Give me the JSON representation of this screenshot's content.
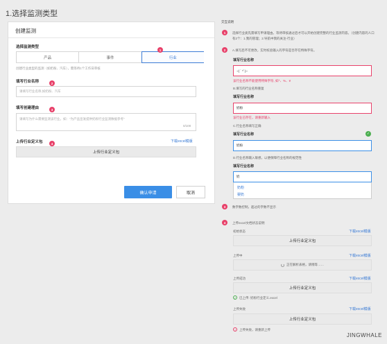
{
  "page": {
    "title": "1.选择监测类型",
    "watermark": "JINGWHALE"
  },
  "card": {
    "title": "创建监测",
    "type_label": "选择监测类型",
    "segments": [
      "产品",
      "事件",
      "行业"
    ],
    "type_hint": "创建行业类型的监测（如奶粉、汽车），需等待1个工作日审核",
    "name_label": "填写行业名称",
    "name_placeholder": "请填写行业名称,如奶粉、汽车",
    "reason_label": "填写创建理由",
    "reason_placeholder": "请填写为什么需要监测该行业。如：\"为产品宣发提供奶粉行业监测数据参考\"",
    "reason_counter": "0/100",
    "upload_label": "上传行业定义包",
    "download_link": "下载excel模版",
    "upload_button": "上传行业定义包",
    "confirm": "确认申请",
    "cancel": "取消"
  },
  "badges": [
    "1",
    "2",
    "3",
    "4"
  ],
  "notes": {
    "title": "交互说明",
    "n1": "选择行业类先需填写申请理由。等待审核通过后才可以开始创建完整的行业监测内容。（创建内容的人口有2个：1.我的管理；2.导航中我的关注-行业）",
    "n2": "A.填写后不可更改，实时校验输入的字符是否存在特殊字符。",
    "n3": "数字数控制，超过的字数不显示",
    "n4": "上传excel文档状态说明"
  },
  "demos": {
    "field_label": "填写行业名称",
    "a_value": "~( ˙ ^˙)~",
    "a_error": "该行业名称不能使用特殊字符, 如^、%、¥",
    "b_label": "B.填写的行业名称重复",
    "b_value": "奶粉",
    "b_error": "该行业已存在，请重新输入",
    "c_label": "C.行业名称填写正确",
    "c_value": "奶粉",
    "d_label": "D.行业名称输入联想，以便保障行业名称的规范性",
    "d_value": "奶",
    "d_options": [
      "奶粉",
      "婴奶"
    ]
  },
  "upload_states": {
    "download": "下载excel模版",
    "initial_label": "初始状态",
    "initial_btn": "上传行业定义包",
    "uploading_label": "上传中",
    "uploading_btn": "正在解析表格，请稍等……",
    "success_label": "上传成功",
    "success_btn": "上传行业定义包",
    "success_msg": "已上传: 奶粉行业定义.excel",
    "fail_label": "上传失败",
    "fail_btn": "上传行业定义包",
    "fail_msg": "上传失败，请重新上传"
  },
  "colors": {
    "accent": "#3a8ee6",
    "badge": "#e8416a",
    "error": "#e8416a",
    "success": "#4caf50"
  }
}
